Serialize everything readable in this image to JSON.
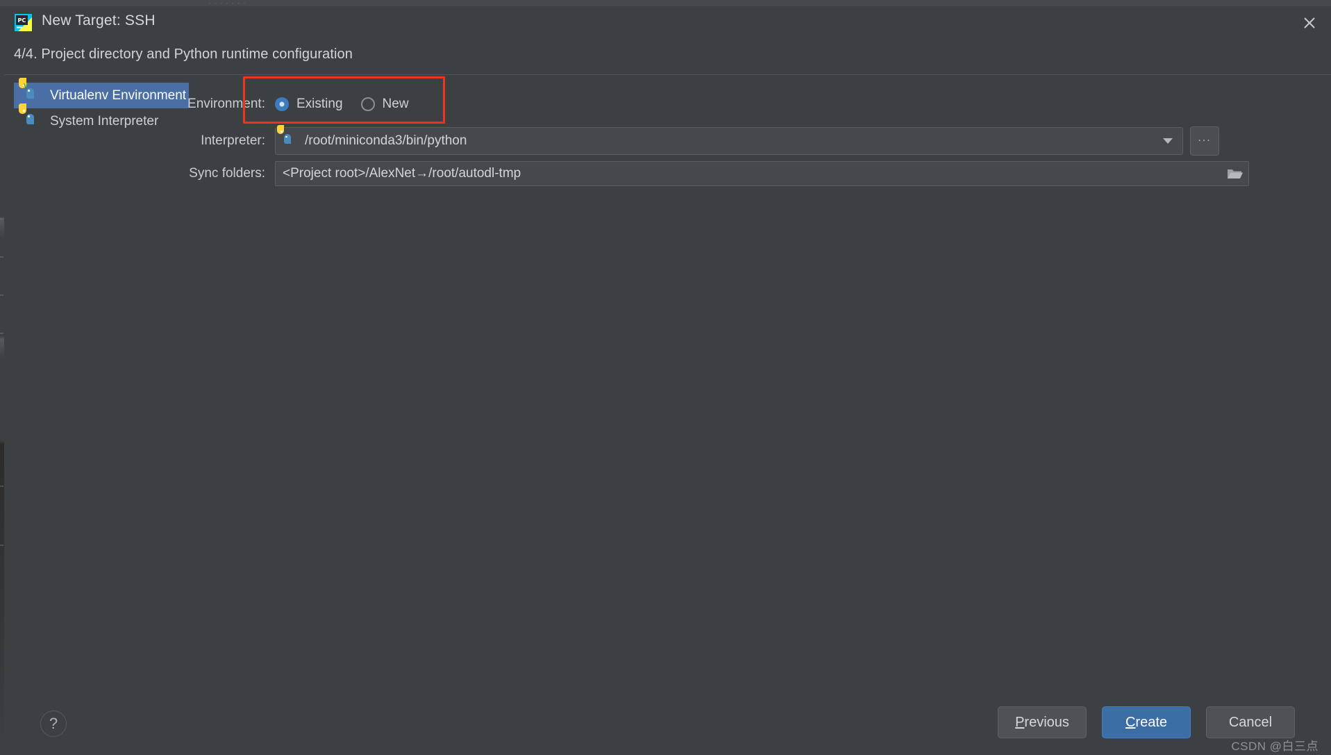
{
  "background": {
    "ghost_window_text": "· · ·   ·   ·      ·     ·"
  },
  "dialog": {
    "title": "New Target: SSH",
    "app_icon": "pycharm-icon",
    "close_icon": "close-icon",
    "subtitle": "4/4. Project directory and Python runtime configuration"
  },
  "sidebar": {
    "items": [
      {
        "label": "Virtualenv Environment",
        "icon": "python-venv-icon",
        "selected": true
      },
      {
        "label": "System Interpreter",
        "icon": "python-icon",
        "selected": false
      }
    ]
  },
  "form": {
    "environment": {
      "label": "Environment:",
      "options": [
        {
          "label": "Existing",
          "checked": true
        },
        {
          "label": "New",
          "checked": false
        }
      ]
    },
    "interpreter": {
      "label": "Interpreter:",
      "value": "/root/miniconda3/bin/python",
      "icon": "python-icon",
      "dropdown_icon": "chevron-down-icon",
      "browse_label": "...",
      "browse_icon": "ellipsis-icon"
    },
    "sync_folders": {
      "label": "Sync folders:",
      "value": "<Project root>/AlexNet→/root/autodl-tmp",
      "browse_icon": "folder-open-icon"
    }
  },
  "annotation": {
    "color": "#ee3322",
    "target": "environment-radio-group"
  },
  "footer": {
    "help_label": "?",
    "help_icon": "question-mark-icon",
    "buttons": [
      {
        "label": "Previous",
        "mnemonic": "P",
        "primary": false
      },
      {
        "label": "Create",
        "mnemonic": "C",
        "primary": true
      },
      {
        "label": "Cancel",
        "mnemonic": "",
        "primary": false
      }
    ]
  },
  "watermark": "CSDN @白三点",
  "colors": {
    "dialog_bg": "#3c4043",
    "field_bg": "#45494c",
    "selection_blue": "#4a6fa5",
    "primary_button": "#3b6ea5",
    "annotation_red": "#ee3322"
  }
}
